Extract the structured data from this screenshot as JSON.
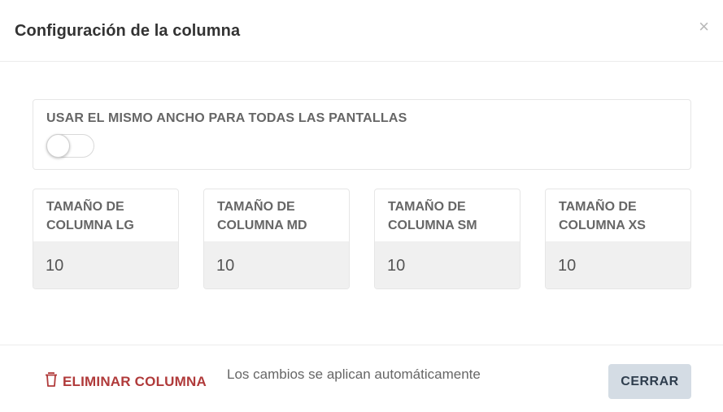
{
  "dialog": {
    "title": "Configuración de la columna",
    "close_glyph": "×"
  },
  "same_width": {
    "label": "USAR EL MISMO ANCHO PARA TODAS LAS PANTALLAS",
    "enabled": false
  },
  "columns": [
    {
      "label": "TAMAÑO DE COLUMNA LG",
      "value": "10"
    },
    {
      "label": "TAMAÑO DE COLUMNA MD",
      "value": "10"
    },
    {
      "label": "TAMAÑO DE COLUMNA SM",
      "value": "10"
    },
    {
      "label": "TAMAÑO DE COLUMNA XS",
      "value": "10"
    }
  ],
  "footer": {
    "delete_label": "ELIMINAR COLUMNA",
    "delete_icon": "trash-icon",
    "note": "Los cambios se aplican automáticamente",
    "close_label": "CERRAR"
  },
  "colors": {
    "danger": "#b03a3a",
    "close_button_bg": "#d4dce4",
    "input_bg": "#f0f0f0"
  }
}
